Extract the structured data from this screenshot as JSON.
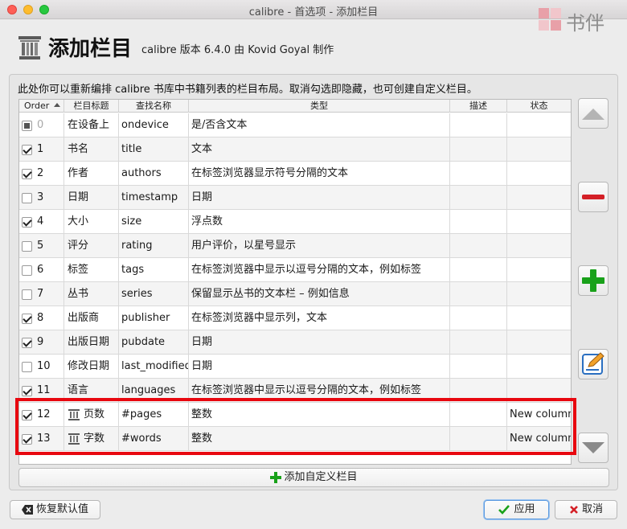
{
  "window": {
    "title": "calibre - 首选项 - 添加栏目"
  },
  "watermark": {
    "text": "书伴"
  },
  "header": {
    "title": "添加栏目",
    "subtitle": "calibre 版本 6.4.0 由 Kovid Goyal 制作"
  },
  "instructions": "此处你可以重新编排 calibre 书库中书籍列表的栏目布局。取消勾选即隐藏，也可创建自定义栏目。",
  "table": {
    "headers": {
      "order": "Order",
      "col_title": "栏目标题",
      "lookup": "查找名称",
      "type": "类型",
      "desc": "描述",
      "status": "状态"
    },
    "rows": [
      {
        "order": "0",
        "check": "partial",
        "title": "在设备上",
        "lookup": "ondevice",
        "type": "是/否含文本",
        "desc": "",
        "status": "",
        "icon": false
      },
      {
        "order": "1",
        "check": "checked",
        "title": "书名",
        "lookup": "title",
        "type": "文本",
        "desc": "",
        "status": "",
        "icon": false
      },
      {
        "order": "2",
        "check": "checked",
        "title": "作者",
        "lookup": "authors",
        "type": "在标签浏览器显示符号分隔的文本",
        "desc": "",
        "status": "",
        "icon": false
      },
      {
        "order": "3",
        "check": "unchecked",
        "title": "日期",
        "lookup": "timestamp",
        "type": "日期",
        "desc": "",
        "status": "",
        "icon": false
      },
      {
        "order": "4",
        "check": "checked",
        "title": "大小",
        "lookup": "size",
        "type": "浮点数",
        "desc": "",
        "status": "",
        "icon": false
      },
      {
        "order": "5",
        "check": "unchecked",
        "title": "评分",
        "lookup": "rating",
        "type": "用户评价，以星号显示",
        "desc": "",
        "status": "",
        "icon": false
      },
      {
        "order": "6",
        "check": "unchecked",
        "title": "标签",
        "lookup": "tags",
        "type": "在标签浏览器中显示以逗号分隔的文本，例如标签",
        "desc": "",
        "status": "",
        "icon": false
      },
      {
        "order": "7",
        "check": "unchecked",
        "title": "丛书",
        "lookup": "series",
        "type": "保留显示丛书的文本栏 – 例如信息",
        "desc": "",
        "status": "",
        "icon": false
      },
      {
        "order": "8",
        "check": "checked",
        "title": "出版商",
        "lookup": "publisher",
        "type": "在标签浏览器中显示列，文本",
        "desc": "",
        "status": "",
        "icon": false
      },
      {
        "order": "9",
        "check": "checked",
        "title": "出版日期",
        "lookup": "pubdate",
        "type": "日期",
        "desc": "",
        "status": "",
        "icon": false
      },
      {
        "order": "10",
        "check": "unchecked",
        "title": "修改日期",
        "lookup": "last_modified",
        "type": "日期",
        "desc": "",
        "status": "",
        "icon": false
      },
      {
        "order": "11",
        "check": "checked",
        "title": "语言",
        "lookup": "languages",
        "type": "在标签浏览器中显示以逗号分隔的文本，例如标签",
        "desc": "",
        "status": "",
        "icon": false
      },
      {
        "order": "12",
        "check": "checked",
        "title": "页数",
        "lookup": "#pages",
        "type": "整数",
        "desc": "",
        "status": "New column",
        "icon": true
      },
      {
        "order": "13",
        "check": "checked",
        "title": "字数",
        "lookup": "#words",
        "type": "整数",
        "desc": "",
        "status": "New column",
        "icon": true
      }
    ]
  },
  "side_buttons": {
    "move_up": "move-up",
    "remove": "remove",
    "add": "add",
    "edit": "edit",
    "move_down": "move-down"
  },
  "add_custom_label": "添加自定义栏目",
  "footer": {
    "restore_label": "恢复默认值",
    "apply_label": "应用",
    "cancel_label": "取消"
  },
  "colors": {
    "highlight": "#e8070f",
    "add_green": "#19a11a",
    "remove_red": "#d42027"
  }
}
